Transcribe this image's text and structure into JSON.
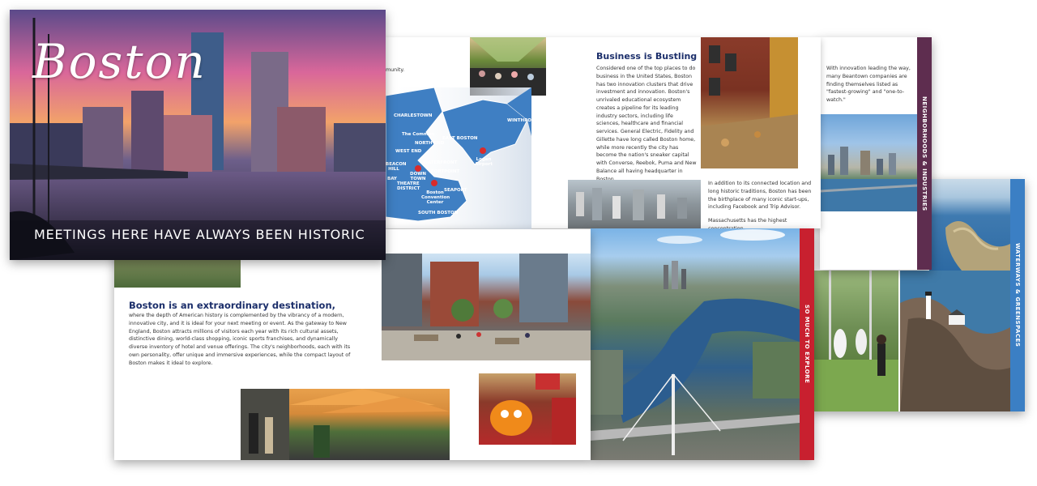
{
  "cover": {
    "script_title": "Boston",
    "tagline": "MEETINGS HERE HAVE ALWAYS BEEN HISTORIC"
  },
  "intro": {
    "heading": "Boston is an extraordinary destination,",
    "body": "where the depth of American history is complemented by the vibrancy of a modern, innovative city, and it is ideal for your next meeting or event.  As the gateway to New England, Boston attracts millions of visitors each year with its rich cultural assets, distinctive dining, world-class shopping, iconic sports franchises, and dynamically diverse inventory of hotel and venue offerings. The city's neighborhoods, each with its own personality, offer unique and immersive experiences, while the compact layout of Boston makes it ideal to explore.",
    "fragment": "munity."
  },
  "map": {
    "labels": [
      "CHARLESTOWN",
      "The Common",
      "NORTH END",
      "WEST END",
      "BEACON HILL",
      "DOWN TOWN",
      "WATERFRONT",
      "FORTPOINT",
      "THEATRE DISTRICT",
      "Boston Convention Center",
      "SEAPORT",
      "SOUTH BOSTON",
      "EAST BOSTON",
      "Logan Airport",
      "WINTHROP",
      "BAY"
    ]
  },
  "business": {
    "heading": "Business is Bustling",
    "body": "Considered one of the top places to do business in the United States, Boston has two innovation clusters that drive investment and innovation.  Boston's unrivaled educational ecosystem creates a pipeline for its leading industry sectors, including life sciences, healthcare and financial services. General Electric, Fidelity and Gillette have long called Boston home, while more recently the city has become the nation's sneaker capital with Converse, Reebok, Puma and New Balance all having headquarter in Boston.",
    "body2": "In addition to its connected location and long historic traditions, Boston has been the birthplace of many iconic start-ups, including Facebook and Trip Advisor.",
    "body3": "Massachusetts has the highest concentration"
  },
  "neighborhoods": {
    "tab": "NEIGHBORHOODS & INDUSTRIES",
    "body": "With innovation leading the way, many Beantown companies are finding themselves listed as \"fastest-growing\" and \"one-to-watch.\""
  },
  "explore": {
    "tab": "SO MUCH TO EXPLORE"
  },
  "waterways": {
    "tab": "WATERWAYS & GREENSPACES"
  },
  "colors": {
    "navy": "#1c2f6b",
    "plum": "#5e2d4f",
    "red": "#c8202f",
    "blue": "#3b7fc4"
  }
}
